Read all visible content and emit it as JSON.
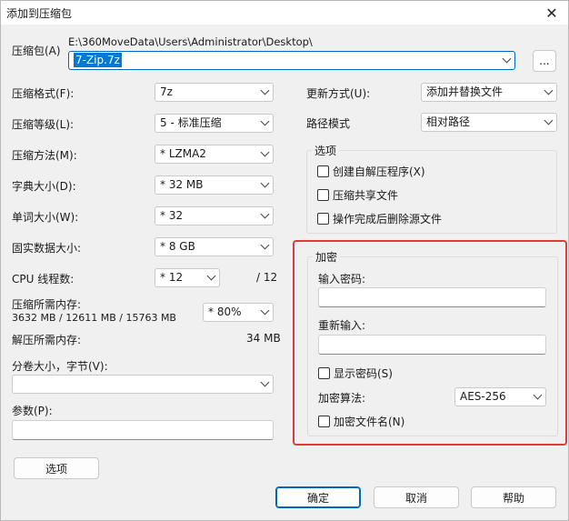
{
  "window": {
    "title": "添加到压缩包",
    "close_glyph": "✕"
  },
  "archive": {
    "label": "压缩包(A)",
    "path": "E:\\360MoveData\\Users\\Administrator\\Desktop\\",
    "filename": "7-Zip.7z",
    "browse_label": "..."
  },
  "left": {
    "format": {
      "label": "压缩格式(F):",
      "value": "7z"
    },
    "level": {
      "label": "压缩等级(L):",
      "value": "5 - 标准压缩"
    },
    "method": {
      "label": "压缩方法(M):",
      "value": "*  LZMA2"
    },
    "dict": {
      "label": "字典大小(D):",
      "value": "*  32 MB"
    },
    "word": {
      "label": "单词大小(W):",
      "value": "*  32"
    },
    "solid": {
      "label": "固实数据大小:",
      "value": "*  8 GB"
    },
    "threads": {
      "label": "CPU 线程数:",
      "value": "*  12",
      "total": "/ 12"
    },
    "mem_comp": {
      "label": "压缩所需内存:",
      "detail": "3632 MB / 12611 MB / 15763 MB",
      "value": "*  80%"
    },
    "mem_decomp": {
      "label": "解压所需内存:",
      "value": "34 MB"
    },
    "volume": {
      "label": "分卷大小，字节(V):",
      "value": ""
    },
    "params": {
      "label": "参数(P):",
      "value": ""
    },
    "options_button": "选项"
  },
  "right": {
    "update": {
      "label": "更新方式(U):",
      "value": "添加并替换文件"
    },
    "pathmode": {
      "label": "路径模式",
      "value": "相对路径"
    },
    "options": {
      "title": "选项",
      "sfx": "创建自解压程序(X)",
      "shared": "压缩共享文件",
      "delete": "操作完成后删除源文件"
    },
    "encryption": {
      "title": "加密",
      "password_label": "输入密码:",
      "reenter_label": "重新输入:",
      "show_password": "显示密码(S)",
      "method_label": "加密算法:",
      "method_value": "AES-256",
      "encrypt_names": "加密文件名(N)"
    }
  },
  "buttons": {
    "ok": "确定",
    "cancel": "取消",
    "help": "帮助"
  },
  "colors": {
    "highlight": "#e0393e",
    "accent": "#0067c0"
  }
}
